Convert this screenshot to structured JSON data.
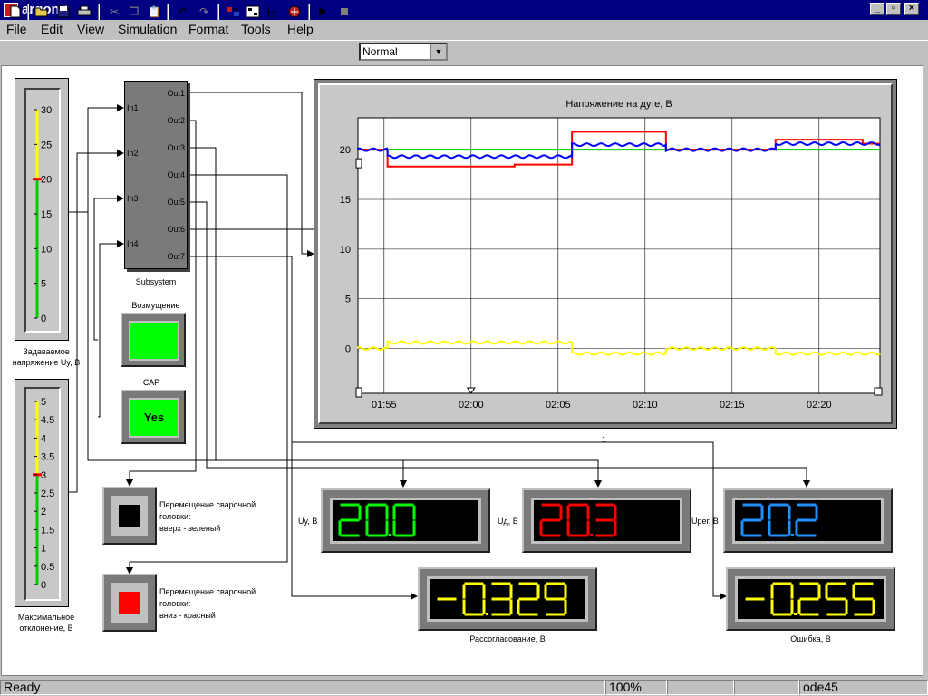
{
  "window": {
    "title": "argon *"
  },
  "menu": [
    "File",
    "Edit",
    "View",
    "Simulation",
    "Format",
    "Tools",
    "Help"
  ],
  "toolbar": {
    "mode": "Normal"
  },
  "status": {
    "state": "Ready",
    "zoom": "100%",
    "solver": "ode45"
  },
  "gauge_top": {
    "label": "Задаваемое напряжение Uy, В",
    "ticks": [
      "30",
      "25",
      "20",
      "15",
      "10",
      "5",
      "0"
    ],
    "value": 20,
    "max": 30
  },
  "gauge_bottom": {
    "label": "Максимальное отклонение, В",
    "ticks": [
      "5",
      "4.5",
      "4",
      "3.5",
      "3",
      "2.5",
      "2",
      "1.5",
      "1",
      "0.5",
      "0"
    ],
    "value": 3,
    "max": 5
  },
  "subsystem": {
    "name": "Subsystem",
    "inputs": [
      "In1",
      "In2",
      "In3",
      "In4"
    ],
    "outputs": [
      "Out1",
      "Out2",
      "Out3",
      "Out4",
      "Out5",
      "Out6",
      "Out7"
    ]
  },
  "disturbance": {
    "label": "Возмущение"
  },
  "cap": {
    "label": "САР",
    "text": "Yes"
  },
  "move_up": {
    "label": "Перемещение сварочной головки: вверх - зеленый",
    "lines": [
      "Перемещение сварочной",
      "головки:",
      "вверх - зеленый"
    ]
  },
  "move_down": {
    "label": "Перемещение сварочной головки: вниз - красный",
    "lines": [
      "Перемещение сварочной",
      "головки:",
      "вниз - красный"
    ]
  },
  "displays": {
    "uy": {
      "label": "Uy, В",
      "value": "20.0",
      "color": "#00ff00"
    },
    "ud": {
      "label": "Uд, В",
      "value": "20.3",
      "color": "#ff0000"
    },
    "ureg": {
      "label": "Uрег, В",
      "value": "20.2",
      "color": "#1e90ff"
    },
    "mismatch": {
      "label": "Рассогласование, В",
      "value": "-0.329",
      "color": "#ffff00"
    },
    "error": {
      "label": "Ошибка, В",
      "value": "-0.255",
      "color": "#ffff00"
    }
  },
  "wire_label": "1",
  "chart_data": {
    "type": "line",
    "title": "Напряжение на дуге, В",
    "xlabel": "",
    "ylabel": "",
    "x_ticks": [
      "01:55",
      "02:00",
      "02:05",
      "02:10",
      "02:15",
      "02:20"
    ],
    "y_ticks": [
      "0",
      "5",
      "10",
      "15",
      "20"
    ],
    "xlim_min": [
      113.5,
      143.5
    ],
    "ylim": [
      -4.5,
      23.2
    ],
    "grid": true,
    "series": [
      {
        "color": "#00cc00",
        "points": [
          [
            113.5,
            20
          ],
          [
            143.5,
            20
          ]
        ]
      },
      {
        "color": "#ff0000",
        "points": [
          [
            113.5,
            20
          ],
          [
            115.2,
            20
          ],
          [
            115.2,
            18.3
          ],
          [
            122.5,
            18.3
          ],
          [
            122.5,
            18.5
          ],
          [
            125.8,
            18.5
          ],
          [
            125.8,
            21.8
          ],
          [
            131.2,
            21.8
          ],
          [
            131.2,
            20
          ],
          [
            137.5,
            20
          ],
          [
            137.5,
            21
          ],
          [
            142.5,
            21
          ],
          [
            142.5,
            20.6
          ],
          [
            143.5,
            20.6
          ]
        ]
      },
      {
        "color": "#0000ff",
        "wavy": true,
        "points": [
          [
            113.5,
            20
          ],
          [
            115.2,
            20
          ],
          [
            115.2,
            19.3
          ],
          [
            125.8,
            19.3
          ],
          [
            125.8,
            20.5
          ],
          [
            131.2,
            20.5
          ],
          [
            131.2,
            20
          ],
          [
            137.5,
            20
          ],
          [
            137.5,
            20.6
          ],
          [
            143.5,
            20.6
          ]
        ]
      },
      {
        "color": "#ffff00",
        "wavy": true,
        "points": [
          [
            113.5,
            0
          ],
          [
            115.2,
            0
          ],
          [
            115.2,
            0.6
          ],
          [
            125.8,
            0.6
          ],
          [
            125.8,
            -0.5
          ],
          [
            131.2,
            -0.5
          ],
          [
            131.2,
            0
          ],
          [
            137.5,
            0
          ],
          [
            137.5,
            -0.5
          ],
          [
            143.5,
            -0.5
          ]
        ]
      }
    ]
  }
}
